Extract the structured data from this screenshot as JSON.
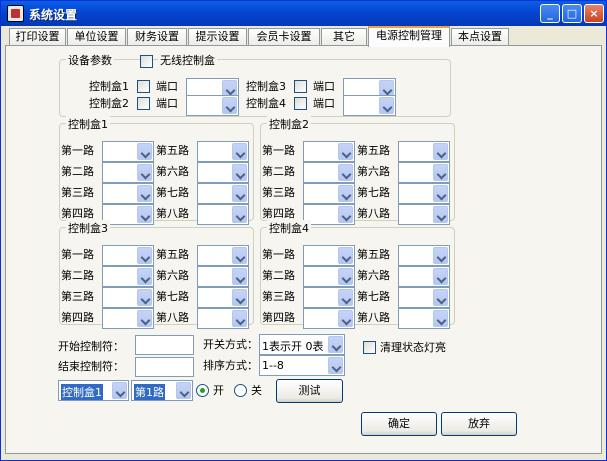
{
  "window": {
    "title": "系统设置",
    "min": "_",
    "max": "□",
    "close": "×"
  },
  "tabs": [
    "打印设置",
    "单位设置",
    "财务设置",
    "提示设置",
    "会员卡设置",
    "其它",
    "电源控制管理",
    "本点设置"
  ],
  "device": {
    "group_title": "设备参数",
    "wireless_label": "无线控制盒",
    "port_label": "端口",
    "boxes": [
      "控制盒1",
      "控制盒2",
      "控制盒3",
      "控制盒4"
    ]
  },
  "box_groups": [
    "控制盒1",
    "控制盒2",
    "控制盒3",
    "控制盒4"
  ],
  "channels": [
    "第一路",
    "第二路",
    "第三路",
    "第四路",
    "第五路",
    "第六路",
    "第七路",
    "第八路"
  ],
  "bottom": {
    "start_label": "开始控制符：",
    "end_label": "结束控制符：",
    "switch_label": "开关方式：",
    "switch_value": "1表示开 0表",
    "sort_label": "排序方式：",
    "sort_value": "1--8",
    "clear_label": "清理状态灯亮",
    "test_box": "控制盒1",
    "test_channel": "第1路",
    "on_label": "开",
    "off_label": "关",
    "test_button": "测试"
  },
  "ok_button": "确定",
  "cancel_button": "放弃"
}
